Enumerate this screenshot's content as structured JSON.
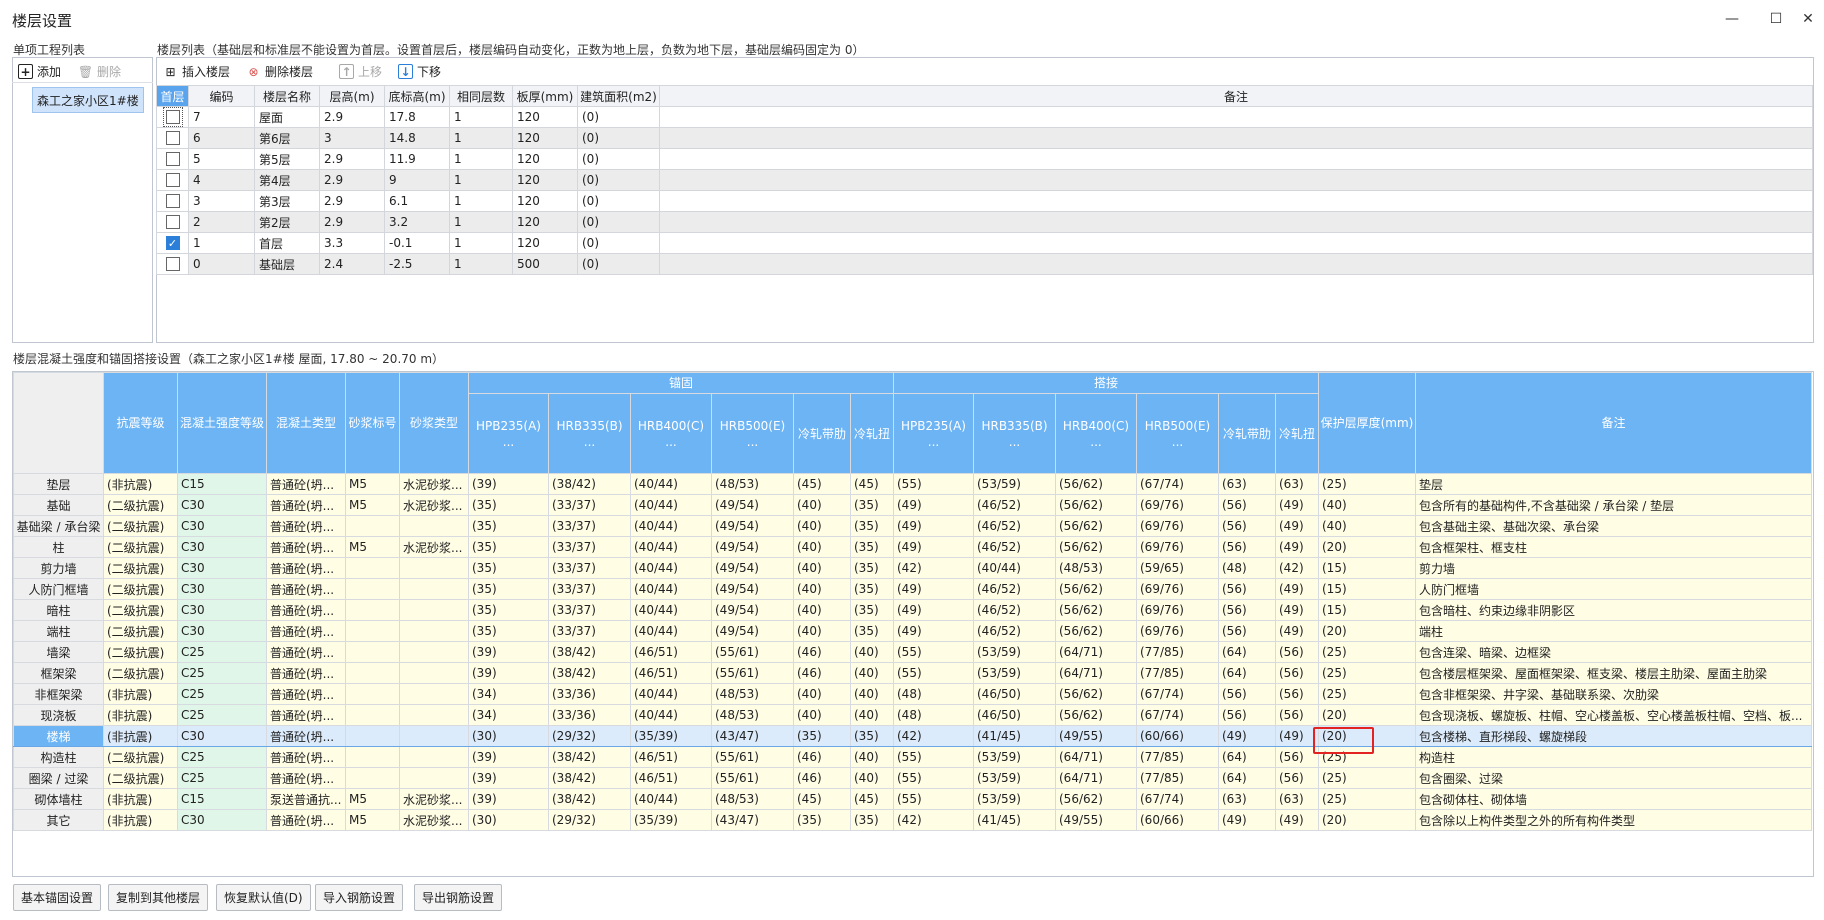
{
  "window": {
    "title": "楼层设置",
    "minimize": "—",
    "maximize": "☐",
    "close": "✕"
  },
  "unit_panel": {
    "label": "单项工程列表",
    "add": "添加",
    "delete": "删除",
    "items": [
      "森工之家小区1#楼"
    ]
  },
  "floor_panel": {
    "label": "楼层列表（基础层和标准层不能设置为首层。设置首层后，楼层编码自动变化，正数为地上层，负数为地下层，基础层编码固定为 0）",
    "toolbar": {
      "insert": "插入楼层",
      "delete": "删除楼层",
      "up": "上移",
      "down": "下移"
    },
    "columns": [
      "首层",
      "编码",
      "楼层名称",
      "层高(m)",
      "底标高(m)",
      "相同层数",
      "板厚(mm)",
      "建筑面积(m2)",
      "备注"
    ],
    "rows": [
      {
        "checked": false,
        "code": "7",
        "name": "屋面",
        "height": "2.9",
        "bottom": "17.8",
        "same": "1",
        "thick": "120",
        "area": "(0)",
        "note": ""
      },
      {
        "checked": false,
        "code": "6",
        "name": "第6层",
        "height": "3",
        "bottom": "14.8",
        "same": "1",
        "thick": "120",
        "area": "(0)",
        "note": ""
      },
      {
        "checked": false,
        "code": "5",
        "name": "第5层",
        "height": "2.9",
        "bottom": "11.9",
        "same": "1",
        "thick": "120",
        "area": "(0)",
        "note": ""
      },
      {
        "checked": false,
        "code": "4",
        "name": "第4层",
        "height": "2.9",
        "bottom": "9",
        "same": "1",
        "thick": "120",
        "area": "(0)",
        "note": ""
      },
      {
        "checked": false,
        "code": "3",
        "name": "第3层",
        "height": "2.9",
        "bottom": "6.1",
        "same": "1",
        "thick": "120",
        "area": "(0)",
        "note": ""
      },
      {
        "checked": false,
        "code": "2",
        "name": "第2层",
        "height": "2.9",
        "bottom": "3.2",
        "same": "1",
        "thick": "120",
        "area": "(0)",
        "note": ""
      },
      {
        "checked": true,
        "code": "1",
        "name": "首层",
        "height": "3.3",
        "bottom": "-0.1",
        "same": "1",
        "thick": "120",
        "area": "(0)",
        "note": ""
      },
      {
        "checked": false,
        "code": "0",
        "name": "基础层",
        "height": "2.4",
        "bottom": "-2.5",
        "same": "1",
        "thick": "500",
        "area": "(0)",
        "note": ""
      }
    ]
  },
  "concrete_panel": {
    "label": "楼层混凝土强度和锚固搭接设置（森工之家小区1#楼 屋面, 17.80 ~ 20.70 m）",
    "group_anchor": "锚固",
    "group_lap": "搭接",
    "columns": [
      "抗震等级",
      "混凝土强度等级",
      "混凝土类型",
      "砂浆标号",
      "砂浆类型"
    ],
    "rebar_cols": [
      "HPB235(A)\n...",
      "HRB335(B)\n...",
      "HRB400(C)\n...",
      "HRB500(E)\n...",
      "冷轧带肋",
      "冷轧扭"
    ],
    "cover_col": "保护层厚度(mm)",
    "note_col": "备注",
    "rows": [
      [
        "垫层",
        "(非抗震)",
        "C15",
        "普通砼(坍...",
        "M5",
        "水泥砂浆...",
        "(39)",
        "(38/42)",
        "(40/44)",
        "(48/53)",
        "(45)",
        "(45)",
        "(55)",
        "(53/59)",
        "(56/62)",
        "(67/74)",
        "(63)",
        "(63)",
        "(25)",
        "垫层"
      ],
      [
        "基础",
        "(二级抗震)",
        "C30",
        "普通砼(坍...",
        "M5",
        "水泥砂浆...",
        "(35)",
        "(33/37)",
        "(40/44)",
        "(49/54)",
        "(40)",
        "(35)",
        "(49)",
        "(46/52)",
        "(56/62)",
        "(69/76)",
        "(56)",
        "(49)",
        "(40)",
        "包含所有的基础构件,不含基础梁 / 承台梁 / 垫层"
      ],
      [
        "基础梁 / 承台梁",
        "(二级抗震)",
        "C30",
        "普通砼(坍...",
        "",
        "",
        "(35)",
        "(33/37)",
        "(40/44)",
        "(49/54)",
        "(40)",
        "(35)",
        "(49)",
        "(46/52)",
        "(56/62)",
        "(69/76)",
        "(56)",
        "(49)",
        "(40)",
        "包含基础主梁、基础次梁、承台梁"
      ],
      [
        "柱",
        "(二级抗震)",
        "C30",
        "普通砼(坍...",
        "M5",
        "水泥砂浆...",
        "(35)",
        "(33/37)",
        "(40/44)",
        "(49/54)",
        "(40)",
        "(35)",
        "(49)",
        "(46/52)",
        "(56/62)",
        "(69/76)",
        "(56)",
        "(49)",
        "(20)",
        "包含框架柱、框支柱"
      ],
      [
        "剪力墙",
        "(二级抗震)",
        "C30",
        "普通砼(坍...",
        "",
        "",
        "(35)",
        "(33/37)",
        "(40/44)",
        "(49/54)",
        "(40)",
        "(35)",
        "(42)",
        "(40/44)",
        "(48/53)",
        "(59/65)",
        "(48)",
        "(42)",
        "(15)",
        "剪力墙"
      ],
      [
        "人防门框墙",
        "(二级抗震)",
        "C30",
        "普通砼(坍...",
        "",
        "",
        "(35)",
        "(33/37)",
        "(40/44)",
        "(49/54)",
        "(40)",
        "(35)",
        "(49)",
        "(46/52)",
        "(56/62)",
        "(69/76)",
        "(56)",
        "(49)",
        "(15)",
        "人防门框墙"
      ],
      [
        "暗柱",
        "(二级抗震)",
        "C30",
        "普通砼(坍...",
        "",
        "",
        "(35)",
        "(33/37)",
        "(40/44)",
        "(49/54)",
        "(40)",
        "(35)",
        "(49)",
        "(46/52)",
        "(56/62)",
        "(69/76)",
        "(56)",
        "(49)",
        "(15)",
        "包含暗柱、约束边缘非阴影区"
      ],
      [
        "端柱",
        "(二级抗震)",
        "C30",
        "普通砼(坍...",
        "",
        "",
        "(35)",
        "(33/37)",
        "(40/44)",
        "(49/54)",
        "(40)",
        "(35)",
        "(49)",
        "(46/52)",
        "(56/62)",
        "(69/76)",
        "(56)",
        "(49)",
        "(20)",
        "端柱"
      ],
      [
        "墙梁",
        "(二级抗震)",
        "C25",
        "普通砼(坍...",
        "",
        "",
        "(39)",
        "(38/42)",
        "(46/51)",
        "(55/61)",
        "(46)",
        "(40)",
        "(55)",
        "(53/59)",
        "(64/71)",
        "(77/85)",
        "(64)",
        "(56)",
        "(25)",
        "包含连梁、暗梁、边框梁"
      ],
      [
        "框架梁",
        "(二级抗震)",
        "C25",
        "普通砼(坍...",
        "",
        "",
        "(39)",
        "(38/42)",
        "(46/51)",
        "(55/61)",
        "(46)",
        "(40)",
        "(55)",
        "(53/59)",
        "(64/71)",
        "(77/85)",
        "(64)",
        "(56)",
        "(25)",
        "包含楼层框架梁、屋面框架梁、框支梁、楼层主肋梁、屋面主肋梁"
      ],
      [
        "非框架梁",
        "(非抗震)",
        "C25",
        "普通砼(坍...",
        "",
        "",
        "(34)",
        "(33/36)",
        "(40/44)",
        "(48/53)",
        "(40)",
        "(40)",
        "(48)",
        "(46/50)",
        "(56/62)",
        "(67/74)",
        "(56)",
        "(56)",
        "(25)",
        "包含非框架梁、井字梁、基础联系梁、次肋梁"
      ],
      [
        "现浇板",
        "(非抗震)",
        "C25",
        "普通砼(坍...",
        "",
        "",
        "(34)",
        "(33/36)",
        "(40/44)",
        "(48/53)",
        "(40)",
        "(40)",
        "(48)",
        "(46/50)",
        "(56/62)",
        "(67/74)",
        "(56)",
        "(56)",
        "(20)",
        "包含现浇板、螺旋板、柱帽、空心楼盖板、空心楼盖板柱帽、空档、板..."
      ],
      [
        "楼梯",
        "(非抗震)",
        "C30",
        "普通砼(坍...",
        "",
        "",
        "(30)",
        "(29/32)",
        "(35/39)",
        "(43/47)",
        "(35)",
        "(35)",
        "(42)",
        "(41/45)",
        "(49/55)",
        "(60/66)",
        "(49)",
        "(49)",
        "(20)",
        "包含楼梯、直形梯段、螺旋梯段"
      ],
      [
        "构造柱",
        "(二级抗震)",
        "C25",
        "普通砼(坍...",
        "",
        "",
        "(39)",
        "(38/42)",
        "(46/51)",
        "(55/61)",
        "(46)",
        "(40)",
        "(55)",
        "(53/59)",
        "(64/71)",
        "(77/85)",
        "(64)",
        "(56)",
        "(25)",
        "构造柱"
      ],
      [
        "圈梁 / 过梁",
        "(二级抗震)",
        "C25",
        "普通砼(坍...",
        "",
        "",
        "(39)",
        "(38/42)",
        "(46/51)",
        "(55/61)",
        "(46)",
        "(40)",
        "(55)",
        "(53/59)",
        "(64/71)",
        "(77/85)",
        "(64)",
        "(56)",
        "(25)",
        "包含圈梁、过梁"
      ],
      [
        "砌体墙柱",
        "(非抗震)",
        "C15",
        "泵送普通抗...",
        "M5",
        "水泥砂浆...",
        "(39)",
        "(38/42)",
        "(40/44)",
        "(48/53)",
        "(45)",
        "(45)",
        "(55)",
        "(53/59)",
        "(56/62)",
        "(67/74)",
        "(63)",
        "(63)",
        "(25)",
        "包含砌体柱、砌体墙"
      ],
      [
        "其它",
        "(非抗震)",
        "C30",
        "普通砼(坍...",
        "M5",
        "水泥砂浆...",
        "(30)",
        "(29/32)",
        "(35/39)",
        "(43/47)",
        "(35)",
        "(35)",
        "(42)",
        "(41/45)",
        "(49/55)",
        "(60/66)",
        "(49)",
        "(49)",
        "(20)",
        "包含除以上构件类型之外的所有构件类型"
      ]
    ],
    "selected_row": 12
  },
  "bottom_buttons": [
    "基本锚固设置",
    "复制到其他楼层",
    "恢复默认值(D)",
    "导入钢筋设置",
    "导出钢筋设置"
  ],
  "colors": {
    "header_blue": "#6db4f5",
    "selected_row": "#dcebfb",
    "highlight_box": "#e32222",
    "grade_cell": "#dff6e8",
    "editable_cell": "#fffde4"
  }
}
